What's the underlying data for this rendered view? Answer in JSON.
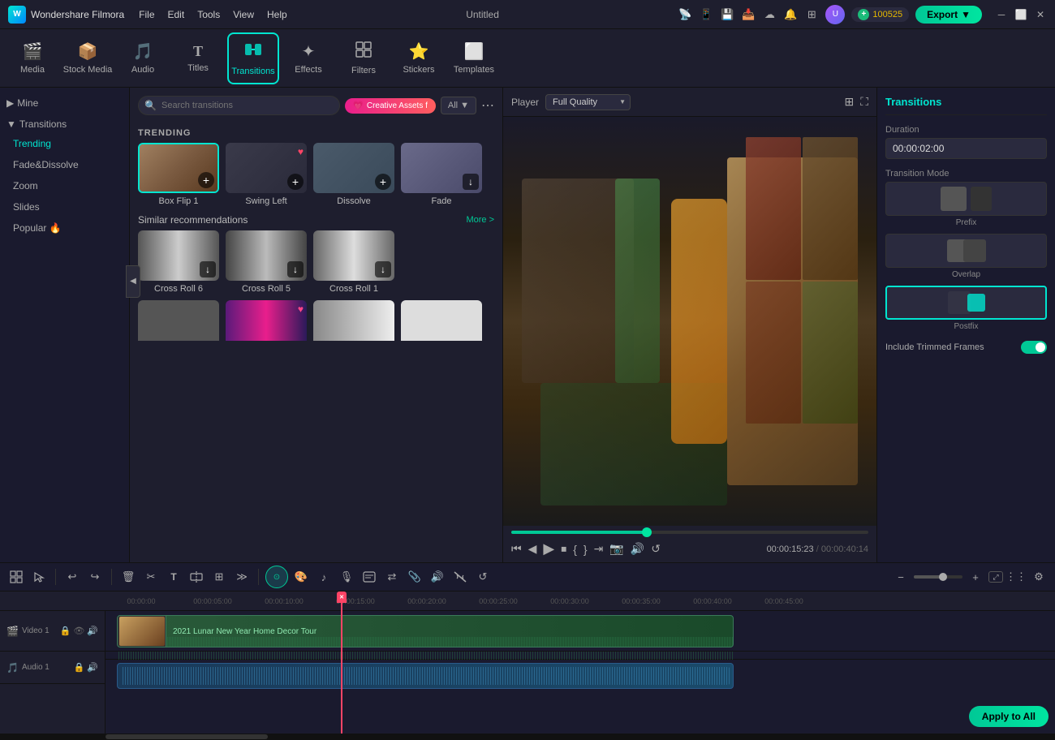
{
  "app": {
    "name": "Wondershare Filmora",
    "title": "Untitled",
    "logo": "W"
  },
  "menu": {
    "items": [
      "File",
      "Edit",
      "Tools",
      "View",
      "Help"
    ]
  },
  "titlebar": {
    "coins": "100525",
    "export_label": "Export"
  },
  "toolbar": {
    "items": [
      {
        "id": "media",
        "label": "Media",
        "icon": "🎬"
      },
      {
        "id": "stock",
        "label": "Stock Media",
        "icon": "📦"
      },
      {
        "id": "audio",
        "label": "Audio",
        "icon": "🎵"
      },
      {
        "id": "titles",
        "label": "Titles",
        "icon": "T"
      },
      {
        "id": "transitions",
        "label": "Transitions",
        "icon": "⬡"
      },
      {
        "id": "effects",
        "label": "Effects",
        "icon": "✦"
      },
      {
        "id": "filters",
        "label": "Filters",
        "icon": "⊞"
      },
      {
        "id": "stickers",
        "label": "Stickers",
        "icon": "★"
      },
      {
        "id": "templates",
        "label": "Templates",
        "icon": "⬜"
      }
    ],
    "active": "transitions"
  },
  "sidebar": {
    "sections": [
      {
        "id": "mine",
        "label": "Mine",
        "collapsed": true,
        "items": []
      },
      {
        "id": "transitions",
        "label": "Transitions",
        "collapsed": false,
        "items": [
          {
            "id": "trending",
            "label": "Trending",
            "active": true
          },
          {
            "id": "fade-dissolve",
            "label": "Fade&Dissolve"
          },
          {
            "id": "zoom",
            "label": "Zoom"
          },
          {
            "id": "slides",
            "label": "Slides"
          },
          {
            "id": "popular",
            "label": "Popular 🔥"
          }
        ]
      }
    ]
  },
  "transitions_panel": {
    "search_placeholder": "Search transitions",
    "creative_assets_label": "Creative Assets f",
    "all_label": "All",
    "trending_label": "TRENDING",
    "trending_items": [
      {
        "id": "box-flip-1",
        "label": "Box Flip 1",
        "style": "box-flip"
      },
      {
        "id": "swing-left",
        "label": "Swing Left",
        "style": "swing-left"
      },
      {
        "id": "dissolve",
        "label": "Dissolve",
        "style": "dissolve"
      },
      {
        "id": "fade",
        "label": "Fade",
        "style": "fade"
      }
    ],
    "similar_label": "Similar recommendations",
    "more_label": "More >",
    "similar_items": [
      {
        "id": "cross-roll-6",
        "label": "Cross Roll 6",
        "style": "cross6"
      },
      {
        "id": "cross-roll-5",
        "label": "Cross Roll 5",
        "style": "cross5"
      },
      {
        "id": "cross-roll-1",
        "label": "Cross Roll 1",
        "style": "cross1"
      }
    ]
  },
  "player": {
    "label": "Player",
    "quality": "Full Quality",
    "current_time": "00:00:15:23",
    "total_time": "00:00:40:14",
    "progress_pct": 38
  },
  "right_panel": {
    "title": "Transitions",
    "duration_label": "Duration",
    "duration_value": "00:00:02:00",
    "transition_mode_label": "Transition Mode",
    "modes": [
      {
        "id": "prefix",
        "label": "Prefix",
        "selected": false
      },
      {
        "id": "overlap",
        "label": "Overlap",
        "selected": false
      },
      {
        "id": "postfix",
        "label": "Postfix",
        "selected": true
      }
    ],
    "include_trimmed_label": "Include Trimmed Frames",
    "apply_all_label": "Apply to All"
  },
  "bottom_toolbar": {
    "undo_label": "Undo",
    "redo_label": "Redo",
    "zoom_label": "Zoom"
  },
  "timeline": {
    "ruler_marks": [
      "00:00:00",
      "00:00:05:00",
      "00:00:10:00",
      "00:00:15:00",
      "00:00:20:00",
      "00:00:25:00",
      "00:00:30:00",
      "00:00:35:00",
      "00:00:40:00",
      "00:00:45:00"
    ],
    "tracks": [
      {
        "id": "video1",
        "label": "Video 1",
        "type": "video",
        "clip_label": "2021 Lunar New Year Home Decor Tour"
      },
      {
        "id": "audio1",
        "label": "Audio 1",
        "type": "audio"
      }
    ]
  }
}
